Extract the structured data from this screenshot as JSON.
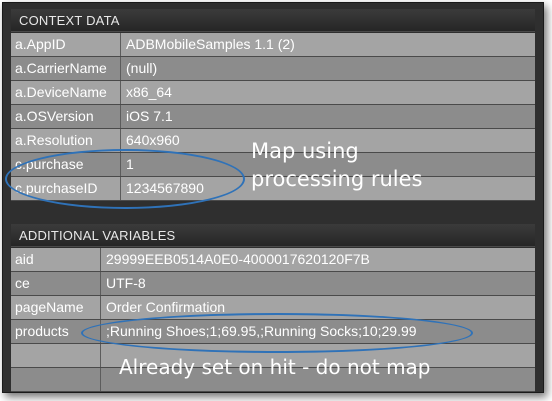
{
  "context_panel": {
    "title": "CONTEXT DATA",
    "rows": [
      {
        "key": "a.AppID",
        "value": "ADBMobileSamples 1.1 (2)"
      },
      {
        "key": "a.CarrierName",
        "value": "(null)"
      },
      {
        "key": "a.DeviceName",
        "value": "x86_64"
      },
      {
        "key": "a.OSVersion",
        "value": "iOS 7.1"
      },
      {
        "key": "a.Resolution",
        "value": "640x960"
      },
      {
        "key": "c.purchase",
        "value": "1"
      },
      {
        "key": "c.purchaseID",
        "value": "1234567890"
      }
    ]
  },
  "additional_panel": {
    "title": "ADDITIONAL VARIABLES",
    "rows": [
      {
        "key": "aid",
        "value": "29999EEB0514A0E0-4000017620120F7B"
      },
      {
        "key": "ce",
        "value": "UTF-8"
      },
      {
        "key": "pageName",
        "value": "Order Confirmation"
      },
      {
        "key": "products",
        "value": ";Running Shoes;1;69.95,;Running Socks;10;29.99"
      },
      {
        "key": "",
        "value": ""
      },
      {
        "key": "",
        "value": ""
      }
    ]
  },
  "annotations": {
    "map_rules_line1": "Map using",
    "map_rules_line2": "processing rules",
    "already_set": "Already set on hit - do not map"
  },
  "colors": {
    "highlight_ellipse": "#2f72b8",
    "row_light": "#a4a4a4",
    "row_dark": "#8c8c8c",
    "background": "#2f2f2f"
  }
}
